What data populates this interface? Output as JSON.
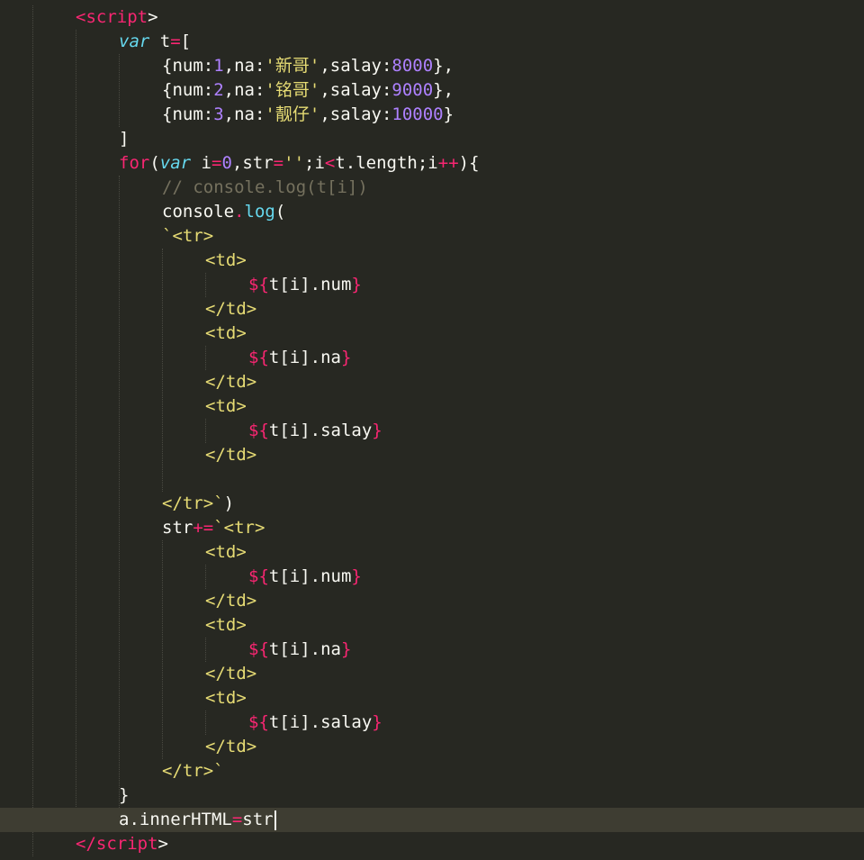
{
  "editor": {
    "theme": "monokai",
    "colors": {
      "background": "#272822",
      "text": "#f8f8f2",
      "keyword": "#f92672",
      "storage": "#66d9ef",
      "number": "#ae81ff",
      "string": "#e6db74",
      "comment": "#75715e",
      "current_line": "#3e3d32"
    },
    "lines": [
      [
        {
          "t": "tag",
          "v": "<script"
        },
        {
          "t": "plain",
          "v": ">"
        }
      ],
      [
        {
          "t": "storage",
          "v": "var"
        },
        {
          "t": "plain",
          "v": " t"
        },
        {
          "t": "op",
          "v": "="
        },
        {
          "t": "plain",
          "v": "["
        }
      ],
      [
        {
          "t": "plain",
          "v": "{num:"
        },
        {
          "t": "num",
          "v": "1"
        },
        {
          "t": "plain",
          "v": ",na:"
        },
        {
          "t": "str",
          "v": "'新哥'"
        },
        {
          "t": "plain",
          "v": ",salay:"
        },
        {
          "t": "num",
          "v": "8000"
        },
        {
          "t": "plain",
          "v": "},"
        }
      ],
      [
        {
          "t": "plain",
          "v": "{num:"
        },
        {
          "t": "num",
          "v": "2"
        },
        {
          "t": "plain",
          "v": ",na:"
        },
        {
          "t": "str",
          "v": "'铭哥'"
        },
        {
          "t": "plain",
          "v": ",salay:"
        },
        {
          "t": "num",
          "v": "9000"
        },
        {
          "t": "plain",
          "v": "},"
        }
      ],
      [
        {
          "t": "plain",
          "v": "{num:"
        },
        {
          "t": "num",
          "v": "3"
        },
        {
          "t": "plain",
          "v": ",na:"
        },
        {
          "t": "str",
          "v": "'靓仔'"
        },
        {
          "t": "plain",
          "v": ",salay:"
        },
        {
          "t": "num",
          "v": "10000"
        },
        {
          "t": "plain",
          "v": "}"
        }
      ],
      [
        {
          "t": "plain",
          "v": "]"
        }
      ],
      [
        {
          "t": "kw",
          "v": "for"
        },
        {
          "t": "plain",
          "v": "("
        },
        {
          "t": "storage",
          "v": "var"
        },
        {
          "t": "plain",
          "v": " i"
        },
        {
          "t": "op",
          "v": "="
        },
        {
          "t": "num",
          "v": "0"
        },
        {
          "t": "plain",
          "v": ",str"
        },
        {
          "t": "op",
          "v": "="
        },
        {
          "t": "str",
          "v": "''"
        },
        {
          "t": "plain",
          "v": ";i"
        },
        {
          "t": "op",
          "v": "<"
        },
        {
          "t": "plain",
          "v": "t.length;i"
        },
        {
          "t": "op",
          "v": "++"
        },
        {
          "t": "plain",
          "v": "){"
        }
      ],
      [
        {
          "t": "cmt",
          "v": "// console.log(t[i])"
        }
      ],
      [
        {
          "t": "plain",
          "v": "console"
        },
        {
          "t": "op",
          "v": "."
        },
        {
          "t": "fn",
          "v": "log"
        },
        {
          "t": "plain",
          "v": "("
        }
      ],
      [
        {
          "t": "str",
          "v": "`<tr>"
        }
      ],
      [
        {
          "t": "str",
          "v": "<td>"
        }
      ],
      [
        {
          "t": "interp",
          "v": "${"
        },
        {
          "t": "plain",
          "v": "t[i].num"
        },
        {
          "t": "interp",
          "v": "}"
        }
      ],
      [
        {
          "t": "str",
          "v": "</td>"
        }
      ],
      [
        {
          "t": "str",
          "v": "<td>"
        }
      ],
      [
        {
          "t": "interp",
          "v": "${"
        },
        {
          "t": "plain",
          "v": "t[i].na"
        },
        {
          "t": "interp",
          "v": "}"
        }
      ],
      [
        {
          "t": "str",
          "v": "</td>"
        }
      ],
      [
        {
          "t": "str",
          "v": "<td>"
        }
      ],
      [
        {
          "t": "interp",
          "v": "${"
        },
        {
          "t": "plain",
          "v": "t[i].salay"
        },
        {
          "t": "interp",
          "v": "}"
        }
      ],
      [
        {
          "t": "str",
          "v": "</td>"
        }
      ],
      [],
      [
        {
          "t": "str",
          "v": "</tr>`"
        },
        {
          "t": "plain",
          "v": ")"
        }
      ],
      [
        {
          "t": "plain",
          "v": "str"
        },
        {
          "t": "op",
          "v": "+="
        },
        {
          "t": "str",
          "v": "`<tr>"
        }
      ],
      [
        {
          "t": "str",
          "v": "<td>"
        }
      ],
      [
        {
          "t": "interp",
          "v": "${"
        },
        {
          "t": "plain",
          "v": "t[i].num"
        },
        {
          "t": "interp",
          "v": "}"
        }
      ],
      [
        {
          "t": "str",
          "v": "</td>"
        }
      ],
      [
        {
          "t": "str",
          "v": "<td>"
        }
      ],
      [
        {
          "t": "interp",
          "v": "${"
        },
        {
          "t": "plain",
          "v": "t[i].na"
        },
        {
          "t": "interp",
          "v": "}"
        }
      ],
      [
        {
          "t": "str",
          "v": "</td>"
        }
      ],
      [
        {
          "t": "str",
          "v": "<td>"
        }
      ],
      [
        {
          "t": "interp",
          "v": "${"
        },
        {
          "t": "plain",
          "v": "t[i].salay"
        },
        {
          "t": "interp",
          "v": "}"
        }
      ],
      [
        {
          "t": "str",
          "v": "</td>"
        }
      ],
      [
        {
          "t": "str",
          "v": "</tr>`"
        }
      ],
      [
        {
          "t": "plain",
          "v": "}"
        }
      ],
      [
        {
          "t": "plain",
          "v": "a.innerHTML"
        },
        {
          "t": "op",
          "v": "="
        },
        {
          "t": "plain",
          "v": "str"
        }
      ],
      [
        {
          "t": "tag",
          "v": "</script"
        },
        {
          "t": "plain",
          "v": ">"
        }
      ]
    ]
  }
}
